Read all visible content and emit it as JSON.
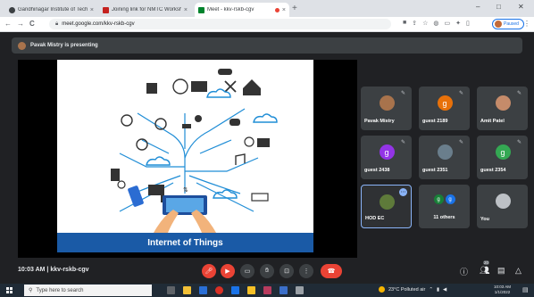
{
  "browser": {
    "tabs": [
      {
        "label": "Gandhinagar Institute of Technol",
        "favicon_color": "#3c4043",
        "active": false
      },
      {
        "label": "Joining link for NMTC Workshop",
        "favicon_color": "#c5221f",
        "active": false
      },
      {
        "label": "Meet - kkv-rskb-cgv",
        "favicon_color": "#00832d",
        "active": true
      }
    ],
    "tab_close": "×",
    "new_tab": "+",
    "window_controls": {
      "minimize": "–",
      "maximize": "□",
      "close": "✕"
    },
    "nav": {
      "back": "←",
      "forward": "→",
      "reload": "C"
    },
    "url": "meet.google.com/kkv-rskb-cgv",
    "profile_label": "Paused",
    "menu": "⋮"
  },
  "meet": {
    "presenting_banner": "Pavak Mistry is presenting",
    "slide_title": "Internet of Things",
    "participants": [
      {
        "name": "Pavak Mistry",
        "initial": "",
        "color": "#a8734c"
      },
      {
        "name": "guest 2189",
        "initial": "g",
        "color": "#e8710a"
      },
      {
        "name": "Amit Patel",
        "initial": "",
        "color": "#c58b6a"
      },
      {
        "name": "guest 2438",
        "initial": "g",
        "color": "#9334e6"
      },
      {
        "name": "guest 2351",
        "initial": "",
        "color": "#6a7e8c"
      },
      {
        "name": "guest 2354",
        "initial": "g",
        "color": "#34a853"
      },
      {
        "name": "HOD EC",
        "initial": "",
        "color": "#5e7a3a"
      },
      {
        "name": "11 others",
        "initial": "g",
        "color": "#188038"
      },
      {
        "name": "You",
        "initial": "",
        "color": "#bdc1c6"
      }
    ],
    "others_second_initial": "g",
    "more_options": "⋯",
    "meeting_info": "10:03 AM | kkv-rskb-cgv",
    "people_count": "20",
    "hangup": "☎"
  },
  "taskbar": {
    "search_placeholder": "Type here to search",
    "weather": "23°C  Polluted air",
    "time": "10:03 AM",
    "date": "1/1/2022"
  },
  "colors": {
    "meet_bg": "#202124",
    "tile_bg": "#3c4043",
    "mic_off_red": "#ea4335",
    "banner_blue": "#1a5aa6"
  }
}
